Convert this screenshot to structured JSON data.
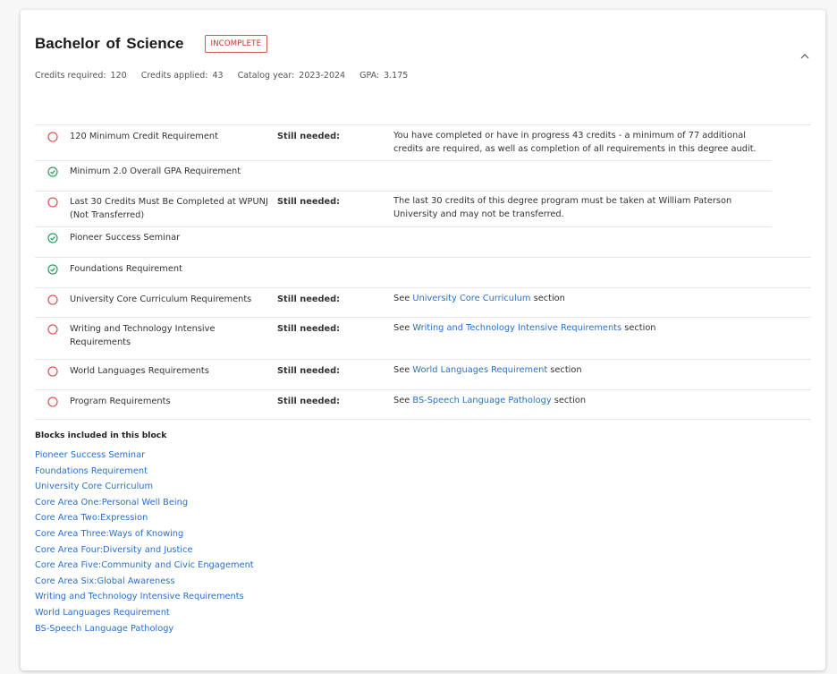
{
  "header": {
    "title": "Bachelor of Science",
    "status_badge": "INCOMPLETE"
  },
  "meta": [
    {
      "label": "Credits required:",
      "value": "120"
    },
    {
      "label": "Credits applied:",
      "value": "43"
    },
    {
      "label": "Catalog year:",
      "value": "2023-2024"
    },
    {
      "label": "GPA:",
      "value": "3.175"
    }
  ],
  "colors": {
    "incomplete": "#e05a5a",
    "complete": "#2e9e5e",
    "link": "#2a6fc9"
  },
  "requirements": [
    {
      "status": "incomplete",
      "name": "120 Minimum Credit Requirement",
      "needed": "Still needed:",
      "desc": "You have completed or have in progress 43 credits - a minimum of 77 additional credits are required, as well as completion of all requirements in this degree audit."
    },
    {
      "status": "complete",
      "name": "Minimum 2.0 Overall GPA Requirement"
    },
    {
      "status": "incomplete",
      "name": "Last 30 Credits Must Be Completed at WPUNJ (Not Transferred)",
      "needed": "Still needed:",
      "desc": "The last 30 credits of this degree program must be taken at William Paterson University and may not be transferred."
    },
    {
      "status": "complete",
      "name": "Pioneer Success Seminar"
    },
    {
      "status": "complete",
      "name": "Foundations Requirement"
    },
    {
      "status": "incomplete",
      "name": "University Core Curriculum Requirements",
      "needed": "Still needed:",
      "see": "See",
      "link": "University Core Curriculum",
      "suffix": "section"
    },
    {
      "status": "incomplete",
      "name": "Writing and Technology Intensive Requirements",
      "needed": "Still needed:",
      "see": "See",
      "link": "Writing and Technology Intensive Requirements",
      "suffix": "section"
    },
    {
      "status": "incomplete",
      "name": "World Languages Requirements",
      "needed": "Still needed:",
      "see": "See",
      "link": "World Languages Requirement",
      "suffix": "section"
    },
    {
      "status": "incomplete",
      "name": "Program Requirements",
      "needed": "Still needed:",
      "see": "See",
      "link": "BS-Speech Language Pathology",
      "suffix": "section"
    }
  ],
  "blocks": {
    "title": "Blocks included in this block",
    "items": [
      "Pioneer Success Seminar",
      "Foundations Requirement",
      "University Core Curriculum",
      "Core Area One:Personal Well Being",
      "Core Area Two:Expression",
      "Core Area Three:Ways of Knowing",
      "Core Area Four:Diversity and Justice",
      "Core Area Five:Community and Civic Engagement",
      "Core Area Six:Global Awareness",
      "Writing and Technology Intensive Requirements",
      "World Languages Requirement",
      "BS-Speech Language Pathology"
    ]
  }
}
